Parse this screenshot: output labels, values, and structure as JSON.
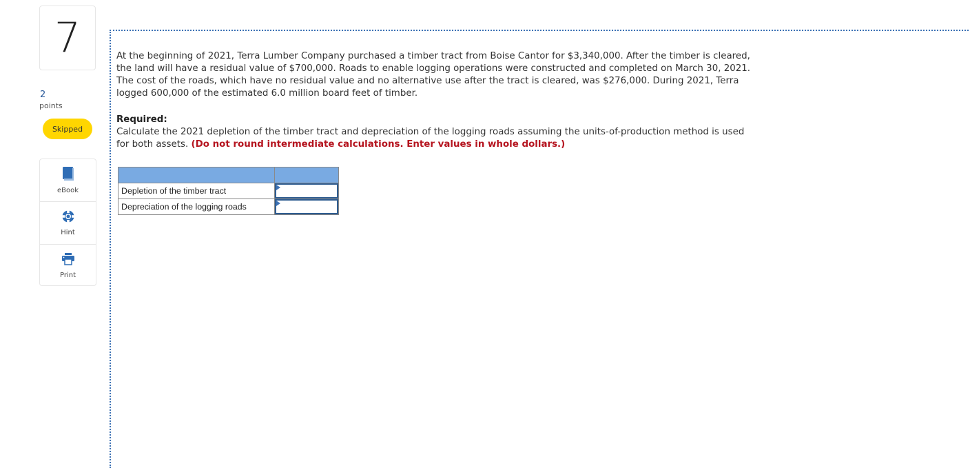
{
  "question": {
    "number": "7",
    "points_value": "2",
    "points_label": "points",
    "status": "Skipped"
  },
  "tools": [
    {
      "icon": "book-icon",
      "label": "eBook"
    },
    {
      "icon": "lifebuoy-icon",
      "label": "Hint"
    },
    {
      "icon": "printer-icon",
      "label": "Print"
    }
  ],
  "problem": {
    "text": "At the beginning of 2021, Terra Lumber Company purchased a timber tract from Boise Cantor for $3,340,000. After the timber is cleared, the land will have a residual value of $700,000. Roads to enable logging operations were constructed and completed on March 30, 2021. The cost of the roads, which have no residual value and no alternative use after the tract is cleared, was $276,000. During 2021, Terra logged 600,000 of the estimated 6.0 million board feet of timber.",
    "required_title": "Required:",
    "required_text": "Calculate the 2021 depletion of the timber tract and depreciation of the logging roads assuming the units-of-production method is used for both assets.",
    "instruction": "(Do not round intermediate calculations. Enter values in whole dollars.)"
  },
  "answer_table": {
    "header": [
      "",
      ""
    ],
    "rows": [
      {
        "label": "Depletion of the timber tract",
        "value": ""
      },
      {
        "label": "Depreciation of the logging roads",
        "value": ""
      }
    ]
  },
  "colors": {
    "accent": "#3d72b5",
    "badge": "#ffd600",
    "table_header": "#79aae2",
    "instruction_red": "#b5141f"
  }
}
